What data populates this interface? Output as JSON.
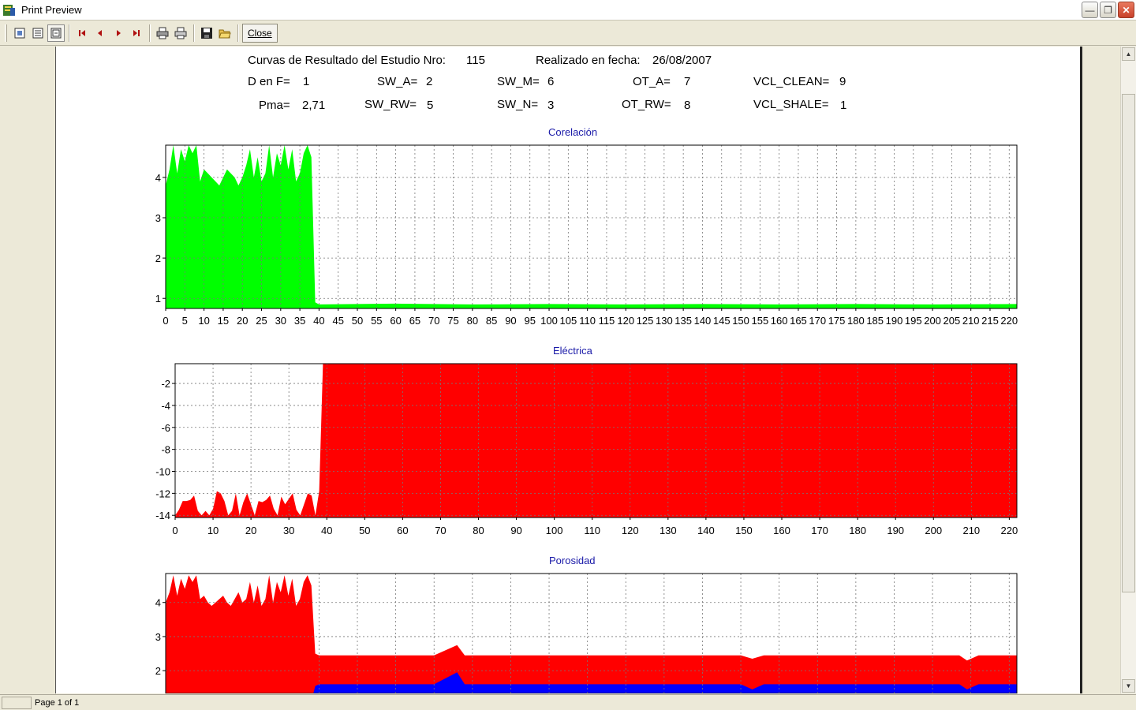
{
  "window": {
    "title": "Print Preview"
  },
  "toolbar": {
    "close_label": "Close",
    "icons": [
      "one-page-icon",
      "two-page-icon",
      "fit-page-icon",
      "first-page-icon",
      "prev-page-icon",
      "next-page-icon",
      "last-page-icon",
      "print-setup-icon",
      "print-icon",
      "save-icon",
      "open-icon"
    ]
  },
  "report": {
    "study_label": "Curvas de Resultado del Estudio Nro:",
    "study_number": "115",
    "date_label": "Realizado en fecha:",
    "date_value": "26/08/2007",
    "params": [
      {
        "label": "D en F=",
        "value": "1"
      },
      {
        "label": "SW_A=",
        "value": "2"
      },
      {
        "label": "SW_M=",
        "value": "6"
      },
      {
        "label": "OT_A=",
        "value": "7"
      },
      {
        "label": "VCL_CLEAN=",
        "value": "9"
      },
      {
        "label": "Pma=",
        "value": "2,71"
      },
      {
        "label": "SW_RW=",
        "value": "5"
      },
      {
        "label": "SW_N=",
        "value": "3"
      },
      {
        "label": "OT_RW=",
        "value": "8"
      },
      {
        "label": "VCL_SHALE=",
        "value": "1"
      }
    ]
  },
  "chart_data": [
    {
      "type": "area",
      "title": "Corelación",
      "xlim": [
        0,
        222
      ],
      "ylim": [
        0.75,
        4.8
      ],
      "xticks": [
        0,
        5,
        10,
        15,
        20,
        25,
        30,
        35,
        40,
        45,
        50,
        55,
        60,
        65,
        70,
        75,
        80,
        85,
        90,
        95,
        100,
        105,
        110,
        115,
        120,
        125,
        130,
        135,
        140,
        145,
        150,
        155,
        160,
        165,
        170,
        175,
        180,
        185,
        190,
        195,
        200,
        205,
        210,
        215,
        220
      ],
      "yticks": [
        1,
        2,
        3,
        4
      ],
      "grid": true,
      "series": [
        {
          "color": "#00ff00",
          "x": [
            0,
            1,
            2,
            3,
            4,
            5,
            6,
            7,
            8,
            9,
            10,
            11,
            12,
            13,
            14,
            15,
            16,
            17,
            18,
            19,
            20,
            21,
            22,
            23,
            24,
            25,
            26,
            27,
            28,
            29,
            30,
            31,
            32,
            33,
            34,
            35,
            36,
            37,
            38,
            39,
            40,
            60,
            80,
            100,
            120,
            140,
            160,
            180,
            200,
            222
          ],
          "values": [
            3.8,
            4.2,
            4.8,
            4.1,
            4.7,
            4.4,
            4.8,
            4.6,
            4.8,
            3.9,
            4.2,
            4.1,
            4.0,
            3.9,
            3.8,
            4.0,
            4.2,
            4.1,
            4.0,
            3.8,
            4.0,
            4.3,
            4.7,
            4.0,
            4.5,
            3.9,
            4.1,
            4.8,
            4.0,
            4.6,
            4.3,
            4.8,
            4.2,
            4.7,
            3.9,
            4.1,
            4.6,
            4.8,
            4.5,
            0.9,
            0.85,
            0.87,
            0.85,
            0.86,
            0.85,
            0.86,
            0.85,
            0.86,
            0.85,
            0.86
          ]
        }
      ]
    },
    {
      "type": "area",
      "title": "Eléctrica",
      "xlim": [
        0,
        222
      ],
      "ylim": [
        -14.2,
        -0.2
      ],
      "xticks": [
        0,
        10,
        20,
        30,
        40,
        50,
        60,
        70,
        80,
        90,
        100,
        110,
        120,
        130,
        140,
        150,
        160,
        170,
        180,
        190,
        200,
        210,
        220
      ],
      "yticks": [
        -2,
        -4,
        -6,
        -8,
        -10,
        -12,
        -14
      ],
      "grid": true,
      "series": [
        {
          "color": "#ff0000",
          "x": [
            0,
            1,
            2,
            3,
            4,
            5,
            6,
            7,
            8,
            9,
            10,
            11,
            12,
            13,
            14,
            15,
            16,
            17,
            18,
            19,
            20,
            21,
            22,
            23,
            24,
            25,
            26,
            27,
            28,
            29,
            30,
            31,
            32,
            33,
            34,
            35,
            36,
            37,
            38,
            39,
            40,
            100,
            160,
            222
          ],
          "values": [
            -14,
            -13.5,
            -12.7,
            -12.7,
            -12.6,
            -12.2,
            -13.6,
            -14,
            -13.6,
            -14,
            -13.4,
            -11.8,
            -12,
            -12.7,
            -14,
            -13.6,
            -12,
            -14,
            -12.8,
            -12,
            -13,
            -14,
            -12.7,
            -12.8,
            -12.6,
            -12.2,
            -13.4,
            -14,
            -12.3,
            -13,
            -12.5,
            -12,
            -13.5,
            -14,
            -13,
            -12,
            -12.2,
            -14,
            -11.8,
            -0.2,
            -0.2,
            -0.2,
            -0.2,
            -0.2
          ]
        }
      ]
    },
    {
      "type": "area",
      "title": "Porosidad",
      "xlim": [
        0,
        222
      ],
      "ylim": [
        1.1,
        4.85
      ],
      "yticks": [
        2,
        3,
        4
      ],
      "grid": true,
      "series": [
        {
          "color": "#ff0000",
          "x": [
            0,
            1,
            2,
            3,
            4,
            5,
            6,
            7,
            8,
            9,
            10,
            11,
            12,
            13,
            14,
            15,
            16,
            17,
            18,
            19,
            20,
            21,
            22,
            23,
            24,
            25,
            26,
            27,
            28,
            29,
            30,
            31,
            32,
            33,
            34,
            35,
            36,
            37,
            38,
            39,
            40,
            70,
            76,
            78,
            80,
            150,
            153,
            156,
            160,
            200,
            207,
            209,
            212,
            222
          ],
          "values": [
            4.0,
            4.3,
            4.8,
            4.2,
            4.7,
            4.4,
            4.8,
            4.6,
            4.8,
            4.1,
            4.2,
            4.0,
            3.9,
            4.0,
            4.1,
            4.2,
            4.0,
            3.9,
            4.1,
            4.3,
            4.0,
            4.1,
            4.6,
            4.0,
            4.5,
            3.9,
            4.1,
            4.8,
            4.0,
            4.6,
            4.3,
            4.8,
            4.2,
            4.7,
            3.9,
            4.1,
            4.6,
            4.8,
            4.5,
            2.5,
            2.45,
            2.45,
            2.75,
            2.45,
            2.45,
            2.45,
            2.35,
            2.45,
            2.45,
            2.45,
            2.45,
            2.3,
            2.45,
            2.45
          ]
        },
        {
          "color": "#0000ff",
          "x": [
            38,
            39,
            40,
            70,
            76,
            78,
            80,
            150,
            153,
            156,
            160,
            200,
            207,
            209,
            212,
            222
          ],
          "values": [
            1.1,
            1.55,
            1.6,
            1.6,
            1.95,
            1.6,
            1.6,
            1.6,
            1.45,
            1.6,
            1.6,
            1.6,
            1.6,
            1.45,
            1.6,
            1.6
          ]
        }
      ]
    }
  ],
  "status": {
    "page_text": "Page 1 of 1"
  }
}
